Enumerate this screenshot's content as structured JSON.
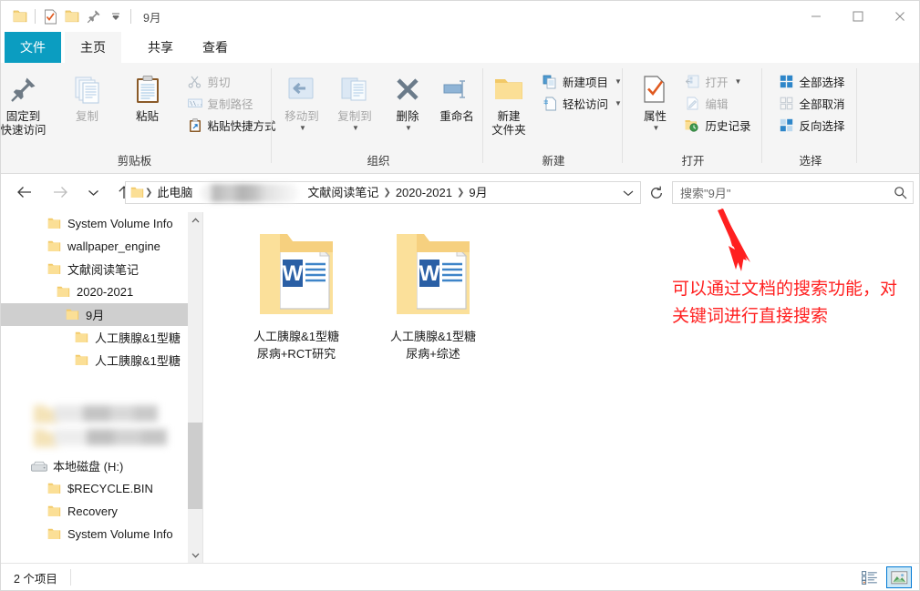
{
  "window": {
    "title": "9月",
    "quick_access": [
      {
        "name": "folder-icon",
        "label": "folder"
      },
      {
        "name": "properties-icon",
        "label": "properties"
      },
      {
        "name": "new-folder-icon",
        "label": "new folder"
      },
      {
        "name": "pin-icon",
        "label": "pin"
      },
      {
        "name": "customize-dropdown-icon",
        "label": "customize"
      }
    ],
    "controls": {
      "minimize": "—",
      "maximize": "□",
      "close": "✕"
    }
  },
  "tabs": [
    {
      "label": "文件",
      "active": false,
      "accent": true
    },
    {
      "label": "主页",
      "active": true,
      "accent": false
    },
    {
      "label": "共享",
      "active": false,
      "accent": false
    },
    {
      "label": "查看",
      "active": false,
      "accent": false
    }
  ],
  "ribbon": {
    "help_label": "?",
    "collapse_label": "^",
    "groups": [
      {
        "name": "clipboard",
        "label": "剪贴板",
        "big_buttons": [
          {
            "label": "固定到\n快速访问",
            "line1": "固定到",
            "line2": "快速访问",
            "icon": "pin-icon",
            "dim": false
          },
          {
            "label": "复制",
            "line1": "复制",
            "line2": "",
            "icon": "copy-icon",
            "dim": true
          },
          {
            "label": "粘贴",
            "line1": "粘贴",
            "line2": "",
            "icon": "paste-icon",
            "dim": false
          }
        ],
        "small_buttons": [
          {
            "label": "剪切",
            "icon": "scissors-icon",
            "dim": true
          },
          {
            "label": "复制路径",
            "icon": "copy-path-icon",
            "dim": true
          },
          {
            "label": "粘贴快捷方式",
            "icon": "paste-shortcut-icon",
            "dim": false
          }
        ]
      },
      {
        "name": "organize",
        "label": "组织",
        "big_buttons": [
          {
            "line1": "移动到",
            "line2": "",
            "icon": "move-to-icon",
            "dim": true,
            "caret": true
          },
          {
            "line1": "复制到",
            "line2": "",
            "icon": "copy-to-icon",
            "dim": true,
            "caret": true
          },
          {
            "line1": "删除",
            "line2": "",
            "icon": "delete-icon",
            "dim": false,
            "caret": true
          },
          {
            "line1": "重命名",
            "line2": "",
            "icon": "rename-icon",
            "dim": false,
            "caret": false
          }
        ],
        "small_buttons": []
      },
      {
        "name": "new",
        "label": "新建",
        "big_buttons": [
          {
            "line1": "新建",
            "line2": "文件夹",
            "icon": "new-folder-icon",
            "dim": false
          }
        ],
        "small_buttons": [
          {
            "label": "新建项目",
            "icon": "new-item-icon",
            "dim": false,
            "caret": true
          },
          {
            "label": "轻松访问",
            "icon": "easy-access-icon",
            "dim": false,
            "caret": true
          }
        ]
      },
      {
        "name": "open",
        "label": "打开",
        "big_buttons": [
          {
            "line1": "属性",
            "line2": "",
            "icon": "properties-icon",
            "dim": false,
            "caret": true
          }
        ],
        "small_buttons": [
          {
            "label": "打开",
            "icon": "open-icon",
            "dim": true,
            "caret": true
          },
          {
            "label": "编辑",
            "icon": "edit-icon",
            "dim": true
          },
          {
            "label": "历史记录",
            "icon": "history-icon",
            "dim": false
          }
        ]
      },
      {
        "name": "select",
        "label": "选择",
        "big_buttons": [],
        "small_buttons": [
          {
            "label": "全部选择",
            "icon": "select-all-icon",
            "dim": false
          },
          {
            "label": "全部取消",
            "icon": "select-none-icon",
            "dim": false
          },
          {
            "label": "反向选择",
            "icon": "invert-selection-icon",
            "dim": false
          }
        ]
      }
    ]
  },
  "navigation": {
    "back": "back-arrow-icon",
    "forward": "forward-arrow-icon",
    "recent": "recent-locations-icon",
    "up": "up-arrow-icon",
    "breadcrumbs": [
      {
        "label": "此电脑",
        "blurred": false
      },
      {
        "label": "",
        "blurred": true
      },
      {
        "label": "文献阅读笔记",
        "blurred": false
      },
      {
        "label": "2020-2021",
        "blurred": false
      },
      {
        "label": "9月",
        "blurred": false
      }
    ],
    "refresh": "refresh-icon"
  },
  "search": {
    "placeholder": "搜索\"9月\"",
    "icon": "search-icon"
  },
  "sidebar": {
    "items": [
      {
        "label": "System Volume Info",
        "indent": 1,
        "icon": "folder-icon",
        "selected": false,
        "blurred": false,
        "drive": false
      },
      {
        "label": "wallpaper_engine",
        "indent": 1,
        "icon": "folder-icon",
        "selected": false,
        "blurred": false,
        "drive": false
      },
      {
        "label": "文献阅读笔记",
        "indent": 1,
        "icon": "folder-icon",
        "selected": false,
        "blurred": false,
        "drive": false
      },
      {
        "label": "2020-2021",
        "indent": 2,
        "icon": "folder-icon",
        "selected": false,
        "blurred": false,
        "drive": false
      },
      {
        "label": "9月",
        "indent": 3,
        "icon": "folder-icon",
        "selected": true,
        "blurred": false,
        "drive": false
      },
      {
        "label": "人工胰腺&1型糖",
        "indent": 4,
        "icon": "folder-icon",
        "selected": false,
        "blurred": false,
        "drive": false
      },
      {
        "label": "人工胰腺&1型糖",
        "indent": 4,
        "icon": "folder-icon",
        "selected": false,
        "blurred": false,
        "drive": false
      },
      {
        "label": "",
        "indent": 1,
        "icon": "folder-icon",
        "selected": false,
        "blurred": true,
        "drive": false
      },
      {
        "label": "",
        "indent": 1,
        "icon": "folder-icon",
        "selected": false,
        "blurred": true,
        "drive": false
      },
      {
        "label": "本地磁盘 (H:)",
        "indent": 0,
        "icon": "drive-icon",
        "selected": false,
        "blurred": false,
        "drive": true
      },
      {
        "label": "$RECYCLE.BIN",
        "indent": 1,
        "icon": "folder-icon",
        "selected": false,
        "blurred": false,
        "drive": false
      },
      {
        "label": "Recovery",
        "indent": 1,
        "icon": "folder-icon",
        "selected": false,
        "blurred": false,
        "drive": false
      },
      {
        "label": "System Volume Info",
        "indent": 1,
        "icon": "folder-icon",
        "selected": false,
        "blurred": false,
        "drive": false
      }
    ],
    "scrollbar": {
      "up": "chevron-up-icon",
      "down": "chevron-down-icon"
    }
  },
  "content": {
    "items": [
      {
        "name_line1": "人工胰腺&1型糖",
        "name_line2": "尿病+RCT研究",
        "icon": "folder-with-word-doc-icon"
      },
      {
        "name_line1": "人工胰腺&1型糖",
        "name_line2": "尿病+综述",
        "icon": "folder-with-word-doc-icon"
      }
    ]
  },
  "annotation": {
    "text": "可以通过文档的搜索功能，对关键词进行直接搜索",
    "color": "#ff2020",
    "arrow": "red-arrow-pointing-to-search-box"
  },
  "statusbar": {
    "item_count": "2 个项目",
    "views": [
      {
        "name": "details-view-button",
        "active": false
      },
      {
        "name": "large-icons-view-button",
        "active": true
      }
    ]
  },
  "colors": {
    "file_tab_accent": "#0b9dc1",
    "ribbon_bg": "#f5f5f5",
    "selection": "#cfcfcf",
    "annotation_red": "#ff2020",
    "help_blue": "#0078d4"
  }
}
